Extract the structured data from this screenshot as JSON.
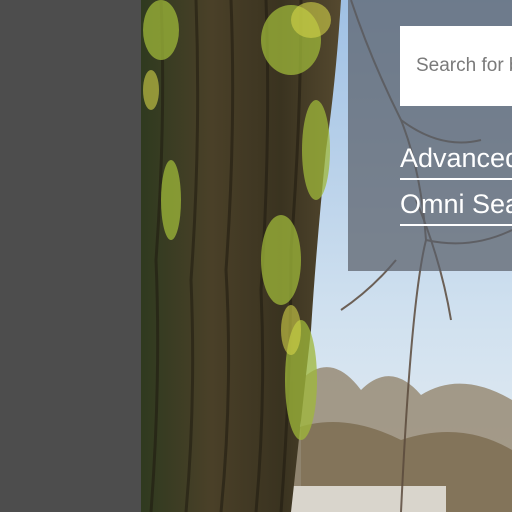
{
  "search": {
    "placeholder": "Search for b"
  },
  "links": {
    "advanced": "Advanced",
    "omni": "Omni Sea"
  },
  "colors": {
    "sidebar": "#4d4d4d",
    "overlay": "#5a5f69",
    "link": "#ffffff",
    "sky": "#c8dcee"
  }
}
